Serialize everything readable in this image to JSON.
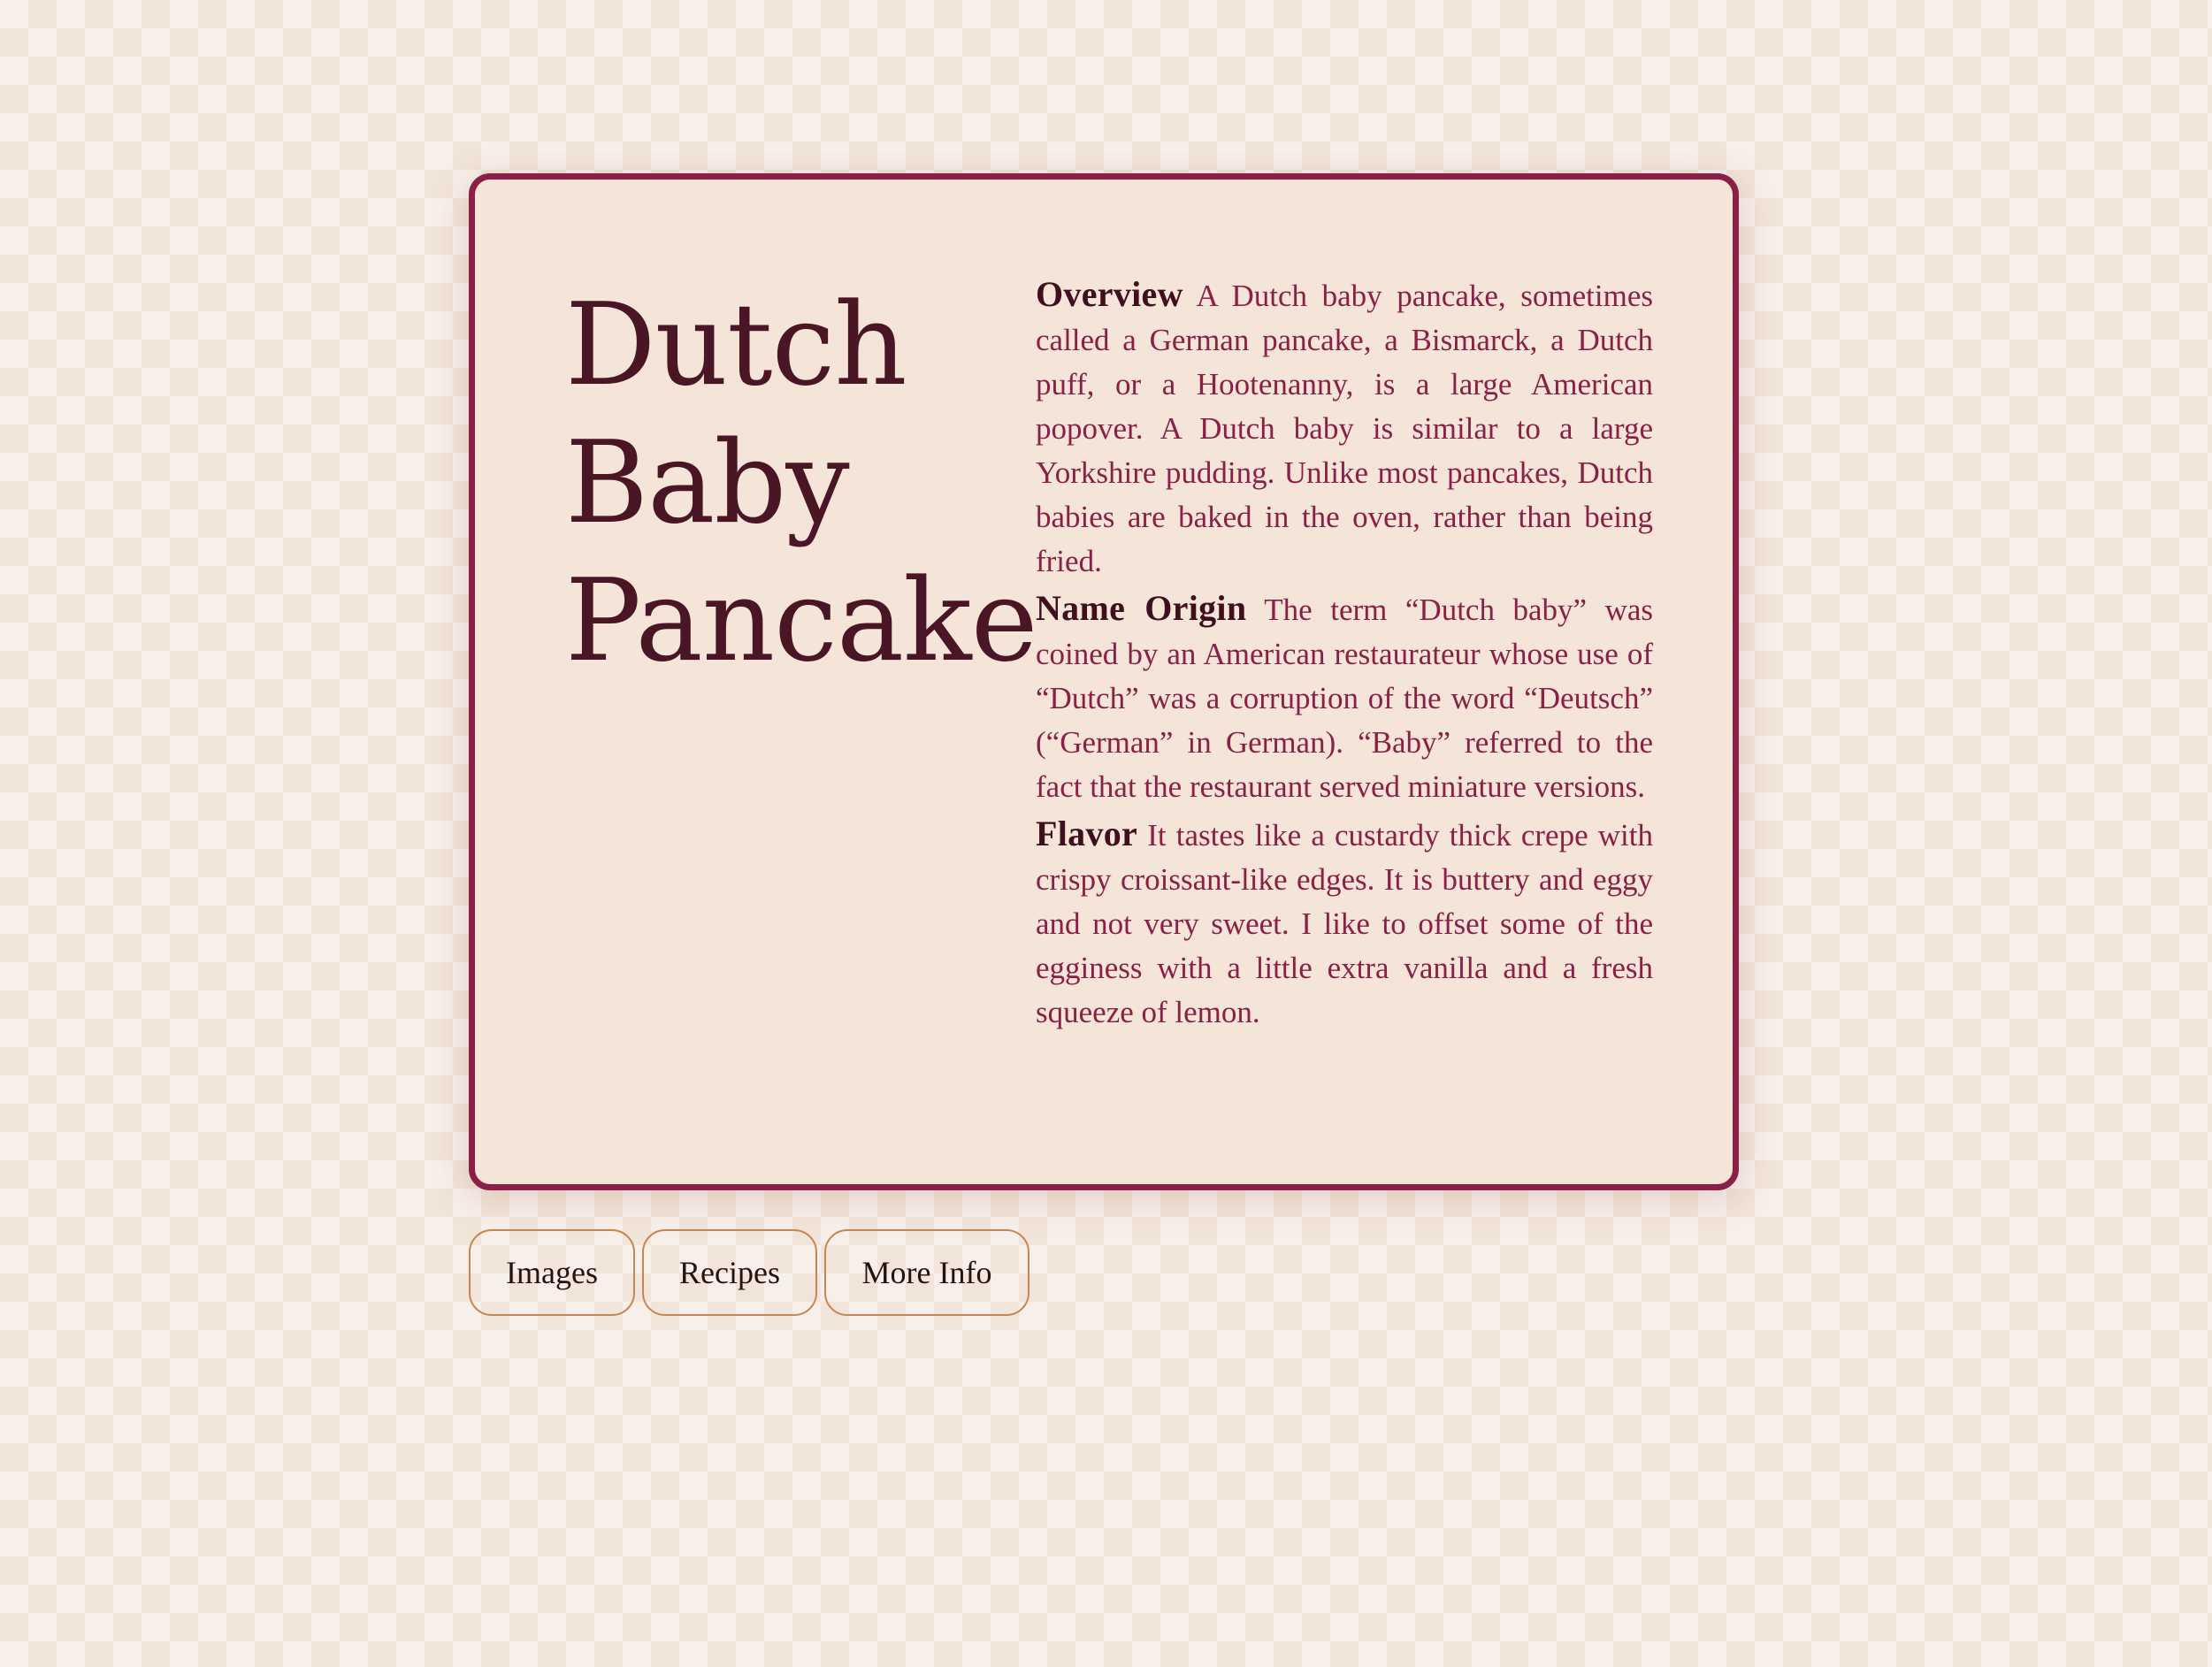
{
  "title_lines": [
    "Dutch",
    "Baby",
    "Pancake"
  ],
  "sections": [
    {
      "heading": "Overview",
      "text": "A Dutch baby pancake, sometimes called a German pancake, a Bismarck, a Dutch puff, or a Hootenanny, is a large American popover. A Dutch baby is similar to a large Yorkshire pudding. Unlike most pancakes, Dutch babies are baked in the oven, rather than being fried."
    },
    {
      "heading": "Name Origin",
      "text": "The term “Dutch baby” was coined by an American restaurateur whose use of “Dutch” was a corruption of the word “Deutsch” (“German” in German). “Baby” referred to the fact that the restaurant served miniature versions."
    },
    {
      "heading": "Flavor",
      "text": "It tastes like a custardy thick crepe with crispy croissant-like edges. It is buttery and eggy and not very sweet. I like to offset some of the egginess with a little extra vanilla and a fresh squeeze of lemon."
    }
  ],
  "tabs": [
    "Images",
    "Recipes",
    "More Info"
  ],
  "colors": {
    "accent": "#8a2047",
    "title": "#4a1524",
    "card_background": "#f4e5d8",
    "tab_border": "#c98454"
  }
}
